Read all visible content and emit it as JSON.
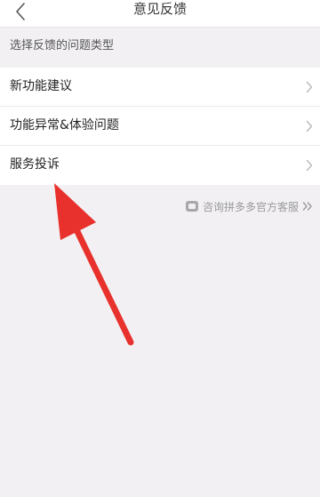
{
  "header": {
    "title": "意见反馈",
    "back_icon": "chevron-left-icon"
  },
  "section": {
    "title": "选择反馈的问题类型"
  },
  "list": {
    "items": [
      {
        "label": "新功能建议"
      },
      {
        "label": "功能异常&体验问题"
      },
      {
        "label": "服务投诉"
      }
    ]
  },
  "contact": {
    "label": "咨询拼多多官方客服",
    "icon": "chat-bubble-icon",
    "arrow_icon": "double-chevron-right-icon"
  },
  "colors": {
    "background": "#f2f0f3",
    "text_primary": "#222222",
    "text_secondary": "#9a9a9a",
    "annotation": "#e8312c"
  }
}
